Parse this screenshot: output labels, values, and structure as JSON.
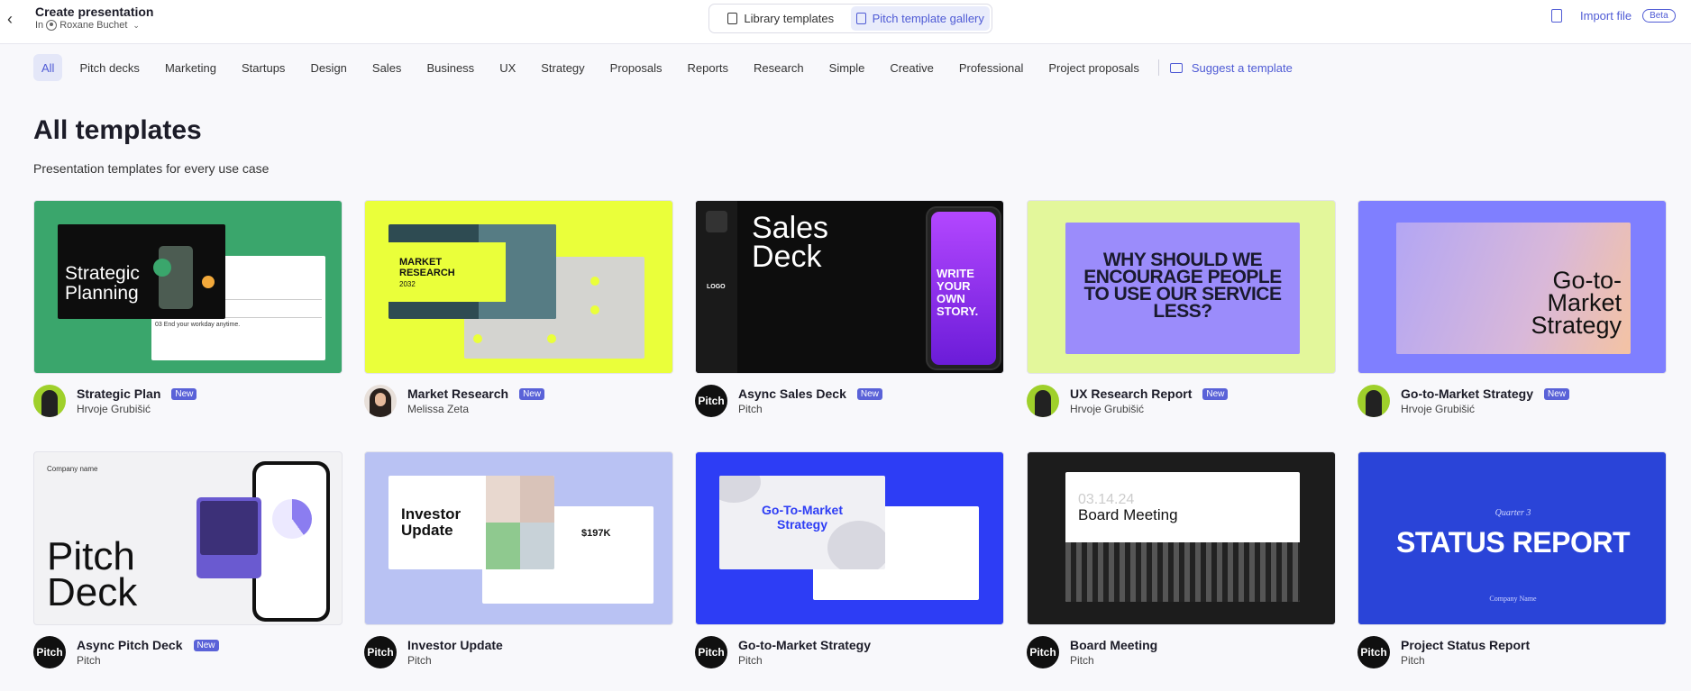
{
  "header": {
    "title": "Create presentation",
    "owner_prefix": "In",
    "owner_name": "Roxane Buchet",
    "tabs": [
      {
        "label": "Library templates"
      },
      {
        "label": "Pitch template gallery"
      }
    ],
    "import_label": "Import file",
    "beta": "Beta"
  },
  "filters": {
    "items": [
      "All",
      "Pitch decks",
      "Marketing",
      "Startups",
      "Design",
      "Sales",
      "Business",
      "UX",
      "Strategy",
      "Proposals",
      "Reports",
      "Research",
      "Simple",
      "Creative",
      "Professional",
      "Project proposals"
    ],
    "suggest": "Suggest a template"
  },
  "main": {
    "heading": "All templates",
    "subheading": "Presentation templates for every use case"
  },
  "badge_new": "New",
  "cards": [
    {
      "title": "Strategic Plan",
      "author": "Hrvoje Grubišić",
      "new": true,
      "thumb_text": "Strategic Planning",
      "rows": [
        "02 Reserve and occupy.",
        "03 End your workday anytime."
      ],
      "bg": "#3aa66c"
    },
    {
      "title": "Market Research",
      "author": "Melissa Zeta",
      "new": true,
      "thumb_text": "MARKET RESEARCH",
      "thumb_year": "2032",
      "bg": "#eaff3a"
    },
    {
      "title": "Async Sales Deck",
      "author": "Pitch",
      "new": true,
      "thumb_text": "Sales Deck",
      "logo": "LOGO",
      "phone_text": "WRITE YOUR OWN STORY.",
      "bg": "#0d0d0d"
    },
    {
      "title": "UX Research Report",
      "author": "Hrvoje Grubišić",
      "new": true,
      "thumb_text": "WHY SHOULD WE ENCOURAGE PEOPLE TO USE OUR SERVICE LESS?",
      "bg": "#e3f79b"
    },
    {
      "title": "Go-to-Market Strategy",
      "author": "Hrvoje Grubišić",
      "new": true,
      "thumb_text": "Go-to-Market Strategy",
      "bg": "#7f7fff"
    },
    {
      "title": "Async Pitch Deck",
      "author": "Pitch",
      "new": true,
      "thumb_text": "Pitch Deck",
      "company": "Company name",
      "bg": "#f2f2f4"
    },
    {
      "title": "Investor Update",
      "author": "Pitch",
      "new": false,
      "thumb_text": "Investor Update",
      "amount": "$197K",
      "bg": "#b9c2f3"
    },
    {
      "title": "Go-to-Market Strategy",
      "author": "Pitch",
      "new": false,
      "thumb_text": "Go-To-Market Strategy",
      "bg": "#2d3df5"
    },
    {
      "title": "Board Meeting",
      "author": "Pitch",
      "new": false,
      "thumb_text": "Board Meeting",
      "date": "03.14.24",
      "bg": "#1c1c1c"
    },
    {
      "title": "Project Status Report",
      "author": "Pitch",
      "new": false,
      "thumb_text": "STATUS REPORT",
      "quarter": "Quarter 3",
      "company": "Company Name",
      "bg": "#2a44d8"
    }
  ],
  "pitch_avatar": "Pitch",
  "colors": {
    "accent": "#4f5bd5",
    "badge": "#5a62d8"
  }
}
